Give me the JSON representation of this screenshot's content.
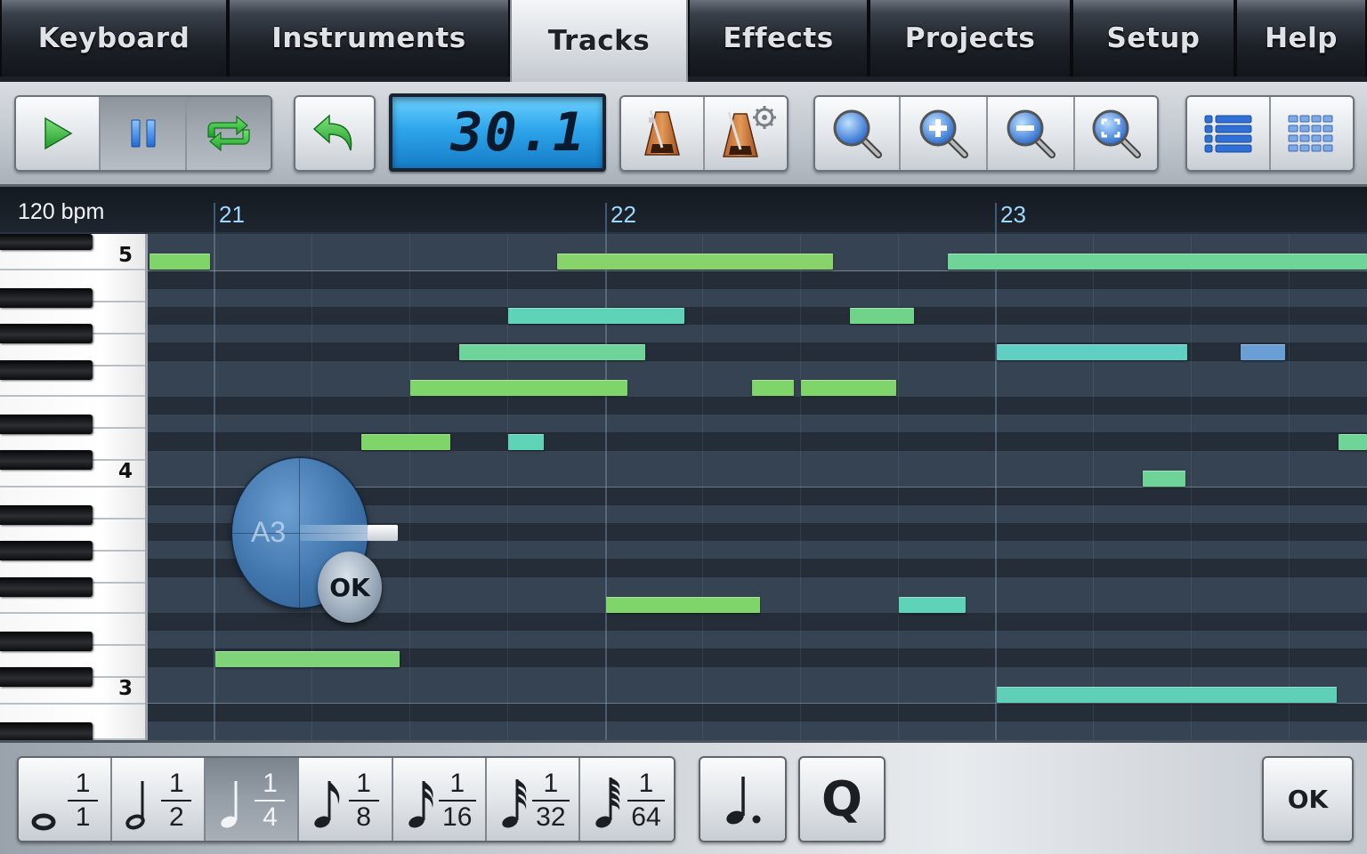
{
  "tabs": [
    {
      "label": "Keyboard",
      "active": false
    },
    {
      "label": "Instruments",
      "active": false
    },
    {
      "label": "Tracks",
      "active": true
    },
    {
      "label": "Effects",
      "active": false
    },
    {
      "label": "Projects",
      "active": false
    },
    {
      "label": "Setup",
      "active": false
    },
    {
      "label": "Help",
      "active": false
    }
  ],
  "toolbar": {
    "play_icon": "play-icon",
    "pause_icon": "pause-icon",
    "loop_icon": "loop-icon",
    "undo_icon": "undo-icon",
    "position_display": "30.1",
    "metronome_icon": "metronome-icon",
    "metronome_settings_icon": "metronome-settings-icon",
    "zoom_icons": [
      "zoom-reset-icon",
      "zoom-in-icon",
      "zoom-out-icon",
      "zoom-fit-icon"
    ],
    "view_icons": [
      "list-view-icon",
      "grid-view-icon"
    ]
  },
  "timeline": {
    "tempo": "120 bpm",
    "bars": [
      "21",
      "22",
      "23"
    ]
  },
  "piano": {
    "octave_labels": [
      "5",
      "4",
      "3"
    ]
  },
  "jog": {
    "note_name": "A3",
    "ok_label": "OK"
  },
  "note_values": [
    {
      "num": "1",
      "den": "1"
    },
    {
      "num": "1",
      "den": "2"
    },
    {
      "num": "1",
      "den": "4",
      "selected": true
    },
    {
      "num": "1",
      "den": "8"
    },
    {
      "num": "1",
      "den": "16"
    },
    {
      "num": "1",
      "den": "32"
    },
    {
      "num": "1",
      "den": "64"
    }
  ],
  "bottom": {
    "quantize_label": "Q",
    "ok_label": "OK"
  },
  "colors": {
    "note_green": "#7fd46a",
    "note_teal": "#5fd3b8",
    "note_blue": "#6a9fd6",
    "lcd": "#2ea6ec",
    "active_tab": "#dfe3e7"
  }
}
